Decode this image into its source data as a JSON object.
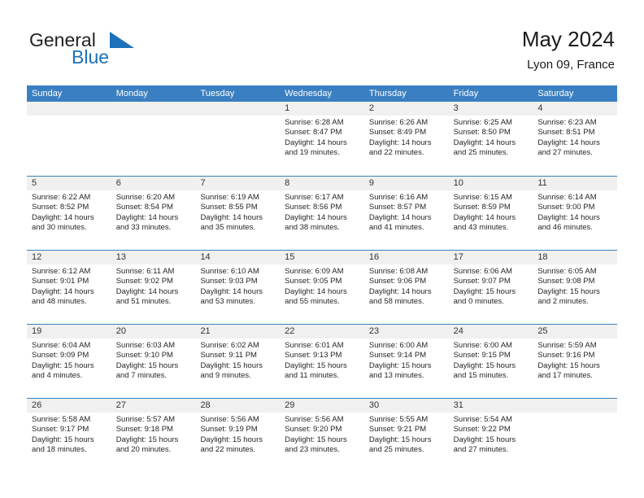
{
  "brand": {
    "word_one": "General",
    "word_two": "Blue",
    "logo_icon": "triangle-logo-icon"
  },
  "header": {
    "title": "May 2024",
    "subtitle": "Lyon 09, France"
  },
  "colors": {
    "header_blue": "#3a7fc1",
    "brand_blue": "#1c71b9",
    "daynum_bar": "#f0f0f0",
    "text": "#262626"
  },
  "calendar": {
    "weekday_headers": [
      "Sunday",
      "Monday",
      "Tuesday",
      "Wednesday",
      "Thursday",
      "Friday",
      "Saturday"
    ],
    "weeks": [
      [
        {
          "day": "",
          "empty": true
        },
        {
          "day": "",
          "empty": true
        },
        {
          "day": "",
          "empty": true
        },
        {
          "day": "1",
          "sunrise": "Sunrise: 6:28 AM",
          "sunset": "Sunset: 8:47 PM",
          "daylight": "Daylight: 14 hours and 19 minutes."
        },
        {
          "day": "2",
          "sunrise": "Sunrise: 6:26 AM",
          "sunset": "Sunset: 8:49 PM",
          "daylight": "Daylight: 14 hours and 22 minutes."
        },
        {
          "day": "3",
          "sunrise": "Sunrise: 6:25 AM",
          "sunset": "Sunset: 8:50 PM",
          "daylight": "Daylight: 14 hours and 25 minutes."
        },
        {
          "day": "4",
          "sunrise": "Sunrise: 6:23 AM",
          "sunset": "Sunset: 8:51 PM",
          "daylight": "Daylight: 14 hours and 27 minutes."
        }
      ],
      [
        {
          "day": "5",
          "sunrise": "Sunrise: 6:22 AM",
          "sunset": "Sunset: 8:52 PM",
          "daylight": "Daylight: 14 hours and 30 minutes."
        },
        {
          "day": "6",
          "sunrise": "Sunrise: 6:20 AM",
          "sunset": "Sunset: 8:54 PM",
          "daylight": "Daylight: 14 hours and 33 minutes."
        },
        {
          "day": "7",
          "sunrise": "Sunrise: 6:19 AM",
          "sunset": "Sunset: 8:55 PM",
          "daylight": "Daylight: 14 hours and 35 minutes."
        },
        {
          "day": "8",
          "sunrise": "Sunrise: 6:17 AM",
          "sunset": "Sunset: 8:56 PM",
          "daylight": "Daylight: 14 hours and 38 minutes."
        },
        {
          "day": "9",
          "sunrise": "Sunrise: 6:16 AM",
          "sunset": "Sunset: 8:57 PM",
          "daylight": "Daylight: 14 hours and 41 minutes."
        },
        {
          "day": "10",
          "sunrise": "Sunrise: 6:15 AM",
          "sunset": "Sunset: 8:59 PM",
          "daylight": "Daylight: 14 hours and 43 minutes."
        },
        {
          "day": "11",
          "sunrise": "Sunrise: 6:14 AM",
          "sunset": "Sunset: 9:00 PM",
          "daylight": "Daylight: 14 hours and 46 minutes."
        }
      ],
      [
        {
          "day": "12",
          "sunrise": "Sunrise: 6:12 AM",
          "sunset": "Sunset: 9:01 PM",
          "daylight": "Daylight: 14 hours and 48 minutes."
        },
        {
          "day": "13",
          "sunrise": "Sunrise: 6:11 AM",
          "sunset": "Sunset: 9:02 PM",
          "daylight": "Daylight: 14 hours and 51 minutes."
        },
        {
          "day": "14",
          "sunrise": "Sunrise: 6:10 AM",
          "sunset": "Sunset: 9:03 PM",
          "daylight": "Daylight: 14 hours and 53 minutes."
        },
        {
          "day": "15",
          "sunrise": "Sunrise: 6:09 AM",
          "sunset": "Sunset: 9:05 PM",
          "daylight": "Daylight: 14 hours and 55 minutes."
        },
        {
          "day": "16",
          "sunrise": "Sunrise: 6:08 AM",
          "sunset": "Sunset: 9:06 PM",
          "daylight": "Daylight: 14 hours and 58 minutes."
        },
        {
          "day": "17",
          "sunrise": "Sunrise: 6:06 AM",
          "sunset": "Sunset: 9:07 PM",
          "daylight": "Daylight: 15 hours and 0 minutes."
        },
        {
          "day": "18",
          "sunrise": "Sunrise: 6:05 AM",
          "sunset": "Sunset: 9:08 PM",
          "daylight": "Daylight: 15 hours and 2 minutes."
        }
      ],
      [
        {
          "day": "19",
          "sunrise": "Sunrise: 6:04 AM",
          "sunset": "Sunset: 9:09 PM",
          "daylight": "Daylight: 15 hours and 4 minutes."
        },
        {
          "day": "20",
          "sunrise": "Sunrise: 6:03 AM",
          "sunset": "Sunset: 9:10 PM",
          "daylight": "Daylight: 15 hours and 7 minutes."
        },
        {
          "day": "21",
          "sunrise": "Sunrise: 6:02 AM",
          "sunset": "Sunset: 9:11 PM",
          "daylight": "Daylight: 15 hours and 9 minutes."
        },
        {
          "day": "22",
          "sunrise": "Sunrise: 6:01 AM",
          "sunset": "Sunset: 9:13 PM",
          "daylight": "Daylight: 15 hours and 11 minutes."
        },
        {
          "day": "23",
          "sunrise": "Sunrise: 6:00 AM",
          "sunset": "Sunset: 9:14 PM",
          "daylight": "Daylight: 15 hours and 13 minutes."
        },
        {
          "day": "24",
          "sunrise": "Sunrise: 6:00 AM",
          "sunset": "Sunset: 9:15 PM",
          "daylight": "Daylight: 15 hours and 15 minutes."
        },
        {
          "day": "25",
          "sunrise": "Sunrise: 5:59 AM",
          "sunset": "Sunset: 9:16 PM",
          "daylight": "Daylight: 15 hours and 17 minutes."
        }
      ],
      [
        {
          "day": "26",
          "sunrise": "Sunrise: 5:58 AM",
          "sunset": "Sunset: 9:17 PM",
          "daylight": "Daylight: 15 hours and 18 minutes."
        },
        {
          "day": "27",
          "sunrise": "Sunrise: 5:57 AM",
          "sunset": "Sunset: 9:18 PM",
          "daylight": "Daylight: 15 hours and 20 minutes."
        },
        {
          "day": "28",
          "sunrise": "Sunrise: 5:56 AM",
          "sunset": "Sunset: 9:19 PM",
          "daylight": "Daylight: 15 hours and 22 minutes."
        },
        {
          "day": "29",
          "sunrise": "Sunrise: 5:56 AM",
          "sunset": "Sunset: 9:20 PM",
          "daylight": "Daylight: 15 hours and 23 minutes."
        },
        {
          "day": "30",
          "sunrise": "Sunrise: 5:55 AM",
          "sunset": "Sunset: 9:21 PM",
          "daylight": "Daylight: 15 hours and 25 minutes."
        },
        {
          "day": "31",
          "sunrise": "Sunrise: 5:54 AM",
          "sunset": "Sunset: 9:22 PM",
          "daylight": "Daylight: 15 hours and 27 minutes."
        },
        {
          "day": "",
          "empty": true
        }
      ]
    ]
  }
}
